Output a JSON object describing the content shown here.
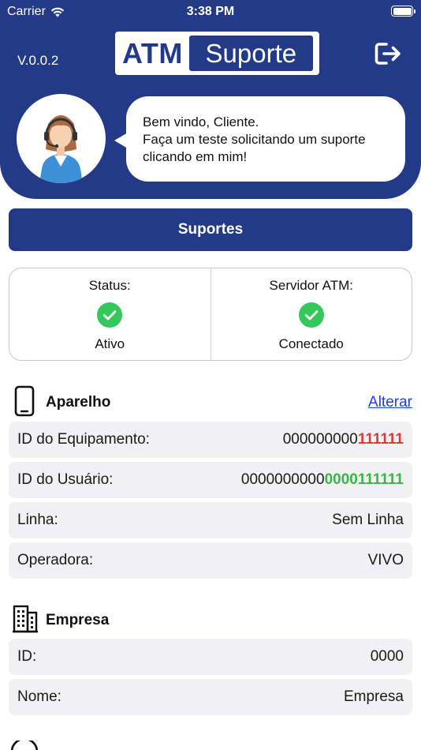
{
  "status_bar": {
    "carrier": "Carrier",
    "time": "3:38 PM"
  },
  "header": {
    "version": "V.0.0.2",
    "logo": {
      "part1": "ATM",
      "part2": "Suporte"
    },
    "welcome_line1": "Bem vindo, Cliente.",
    "welcome_line2": "Faça um teste solicitando um suporte clicando em mim!"
  },
  "support_button": "Suportes",
  "status": {
    "left": {
      "title": "Status:",
      "value": "Ativo"
    },
    "right": {
      "title": "Servidor ATM:",
      "value": "Conectado"
    }
  },
  "device": {
    "title": "Aparelho",
    "edit_link": "Alterar",
    "rows": [
      {
        "label": "ID do Equipamento:",
        "value_plain": "000000000",
        "value_highlight": "111111"
      },
      {
        "label": "ID do Usuário:",
        "value_plain": "0000000000",
        "value_highlight": "0000111111"
      },
      {
        "label": "Linha:",
        "value_plain": "Sem Linha",
        "value_highlight": ""
      },
      {
        "label": "Operadora:",
        "value_plain": "VIVO",
        "value_highlight": ""
      }
    ]
  },
  "company": {
    "title": "Empresa",
    "rows": [
      {
        "label": "ID:",
        "value": "0000"
      },
      {
        "label": "Nome:",
        "value": "Empresa"
      }
    ]
  },
  "colors": {
    "brand": "#233a88",
    "id_red": "#d93b3b",
    "id_green": "#3ab54a",
    "check_green": "#34c759",
    "link": "#1d3ef0"
  }
}
